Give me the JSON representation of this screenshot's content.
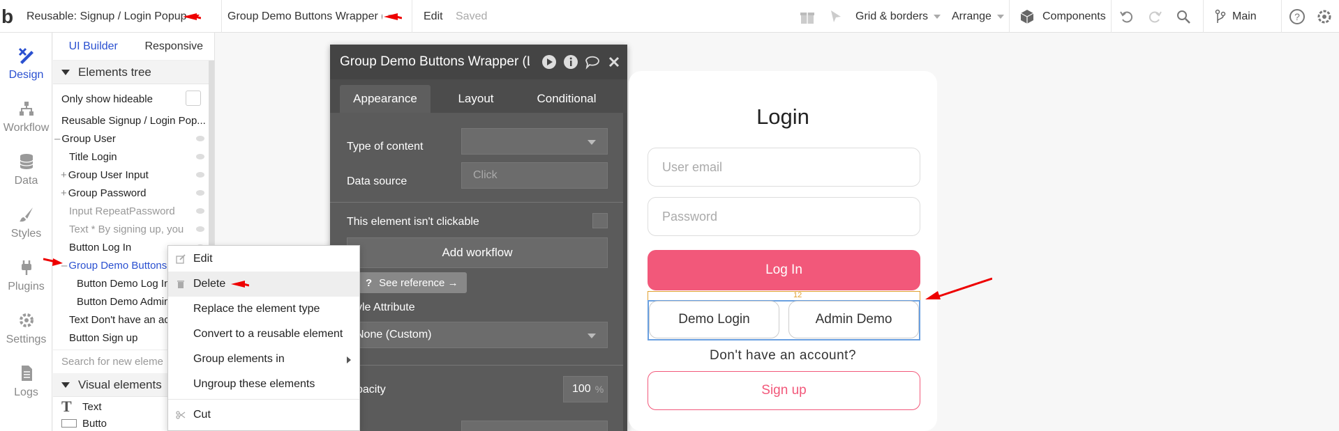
{
  "topbar": {
    "logo": "b",
    "page_name": "Reusable: Signup / Login Popup",
    "element_name": "Group Demo Buttons Wrapper (Lo",
    "edit": "Edit",
    "saved": "Saved",
    "grid": "Grid & borders",
    "arrange": "Arrange",
    "components": "Components",
    "branch": "Main"
  },
  "rail": [
    {
      "label": "Design",
      "icon": "design-icon"
    },
    {
      "label": "Workflow",
      "icon": "workflow-icon"
    },
    {
      "label": "Data",
      "icon": "data-icon"
    },
    {
      "label": "Styles",
      "icon": "styles-icon"
    },
    {
      "label": "Plugins",
      "icon": "plugins-icon"
    },
    {
      "label": "Settings",
      "icon": "settings-icon"
    },
    {
      "label": "Logs",
      "icon": "logs-icon"
    }
  ],
  "left_panel": {
    "tabs": [
      "UI Builder",
      "Responsive"
    ],
    "section_tree": "Elements tree",
    "only_hideable": "Only show hideable",
    "tree": [
      "Reusable Signup / Login Pop...",
      "Group User",
      "Title Login",
      "Group User Input",
      "Group Password",
      "Input RepeatPassword",
      "Text * By signing up, you",
      "Button Log In",
      "Group Demo Buttons",
      "Button Demo Log In",
      "Button Demo Admin",
      "Text Don't have an acc",
      "Button Sign up"
    ],
    "search_placeholder": "Search for new eleme",
    "section_visual": "Visual elements",
    "visual": [
      "Text",
      "Butto"
    ]
  },
  "prop_editor": {
    "title": "Group Demo Buttons Wrapper (Lo",
    "tabs": [
      "Appearance",
      "Layout",
      "Conditional"
    ],
    "type_of_content": "Type of content",
    "data_source": "Data source",
    "data_source_placeholder": "Click",
    "not_clickable": "This element isn't clickable",
    "add_workflow": "Add workflow",
    "see_reference": "See reference →",
    "style_attribute": "yle Attribute",
    "style_value": "None (Custom)",
    "opacity": "pacity",
    "opacity_value": "100",
    "opacity_unit": "%"
  },
  "preview": {
    "title": "Login",
    "email_placeholder": "User email",
    "password_placeholder": "Password",
    "login_button": "Log In",
    "demo_login": "Demo Login",
    "admin_demo": "Admin Demo",
    "spacing": "12",
    "no_account": "Don't have an account?",
    "signup": "Sign up"
  },
  "context_menu": [
    {
      "label": "Edit",
      "icon": "edit-icon"
    },
    {
      "label": "Delete",
      "icon": "trash-icon"
    },
    {
      "label": "Replace the element type",
      "icon": ""
    },
    {
      "label": "Convert to a reusable element",
      "icon": ""
    },
    {
      "label": "Group elements in",
      "icon": ""
    },
    {
      "label": "Ungroup these elements",
      "icon": ""
    },
    {
      "label": "Cut",
      "icon": "scissors-icon"
    }
  ],
  "colors": {
    "accent": "#2a50d0",
    "pink": "#f2587a",
    "annotation_red": "#e00000"
  }
}
